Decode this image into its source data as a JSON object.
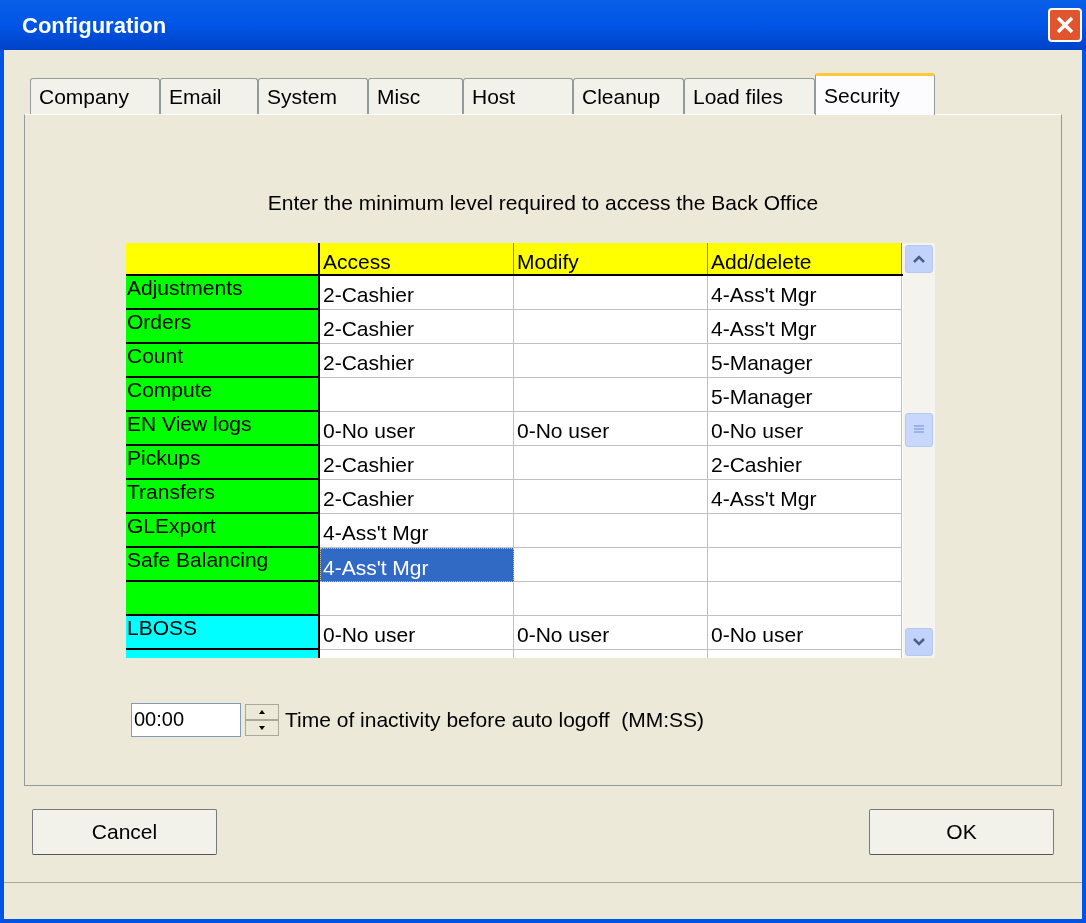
{
  "window": {
    "title": "Configuration"
  },
  "tabs": [
    {
      "label": "Company",
      "selected": false
    },
    {
      "label": "Email",
      "selected": false
    },
    {
      "label": "System",
      "selected": false
    },
    {
      "label": "Misc",
      "selected": false
    },
    {
      "label": "Host",
      "selected": false
    },
    {
      "label": "Cleanup",
      "selected": false
    },
    {
      "label": "Load files",
      "selected": false
    },
    {
      "label": "Security",
      "selected": true
    }
  ],
  "instruction": "Enter the minimum level required to access the Back Office",
  "table": {
    "columns": [
      "Access",
      "Modify",
      "Add/delete"
    ],
    "rows": [
      {
        "label": "Adjustments",
        "color": "#00ff00",
        "cells": [
          {
            "text": "2-Cashier",
            "selected": false
          },
          {
            "selected": false
          },
          {
            "text": "4-Ass't Mgr",
            "selected": false
          }
        ]
      },
      {
        "label": "Orders",
        "color": "#00ff00",
        "cells": [
          {
            "text": "2-Cashier",
            "selected": false
          },
          {
            "selected": false
          },
          {
            "text": "4-Ass't Mgr",
            "selected": false
          }
        ]
      },
      {
        "label": "Count",
        "color": "#00ff00",
        "cells": [
          {
            "text": "2-Cashier",
            "selected": false
          },
          {
            "selected": false
          },
          {
            "text": "5-Manager",
            "selected": false
          }
        ]
      },
      {
        "label": "Compute",
        "color": "#00ff00",
        "cells": [
          {
            "selected": false
          },
          {
            "selected": false
          },
          {
            "text": "5-Manager",
            "selected": false
          }
        ]
      },
      {
        "label": "EN View logs",
        "color": "#00ff00",
        "cells": [
          {
            "text": "0-No user",
            "selected": false
          },
          {
            "text": "0-No user",
            "selected": false
          },
          {
            "text": "0-No user",
            "selected": false
          }
        ]
      },
      {
        "label": "Pickups",
        "color": "#00ff00",
        "cells": [
          {
            "text": "2-Cashier",
            "selected": false
          },
          {
            "selected": false
          },
          {
            "text": "2-Cashier",
            "selected": false
          }
        ]
      },
      {
        "label": "Transfers",
        "color": "#00ff00",
        "cells": [
          {
            "text": "2-Cashier",
            "selected": false
          },
          {
            "selected": false
          },
          {
            "text": "4-Ass't Mgr",
            "selected": false
          }
        ]
      },
      {
        "label": "GLExport",
        "color": "#00ff00",
        "cells": [
          {
            "text": "4-Ass't Mgr",
            "selected": false
          },
          {
            "selected": false
          },
          {
            "selected": false
          }
        ]
      },
      {
        "label": "Safe Balancing",
        "color": "#00ff00",
        "cells": [
          {
            "text": "4-Ass't Mgr",
            "selected": true
          },
          {
            "selected": false
          },
          {
            "selected": false
          }
        ]
      },
      {
        "color": "#00ff00",
        "cells": [
          {
            "selected": false
          },
          {
            "selected": false
          },
          {
            "selected": false
          }
        ]
      },
      {
        "label": "LBOSS",
        "color": "#00ffff",
        "cells": [
          {
            "text": "0-No user",
            "selected": false
          },
          {
            "text": "0-No user",
            "selected": false
          },
          {
            "text": "0-No user",
            "selected": false
          }
        ]
      },
      {
        "color": "#00ffff",
        "cells": [
          {
            "selected": false
          },
          {
            "selected": false
          },
          {
            "selected": false
          }
        ]
      }
    ]
  },
  "timeout": {
    "value": "00:00",
    "label": "Time of inactivity before auto logoff  (MM:SS)"
  },
  "buttons": [
    "Cancel",
    "OK"
  ]
}
